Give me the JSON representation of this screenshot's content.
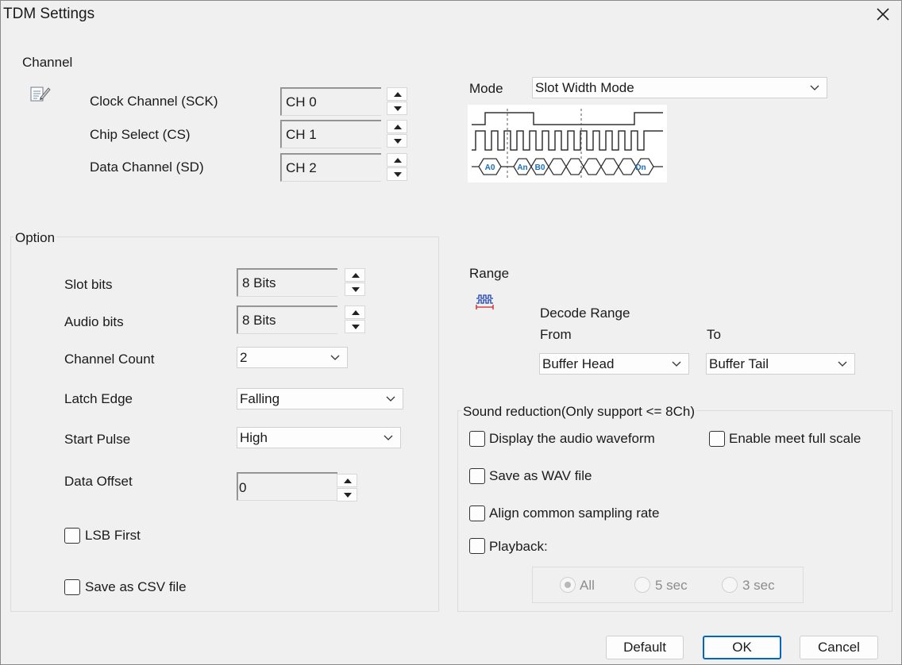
{
  "window": {
    "title": "TDM Settings",
    "close_icon": "close-icon"
  },
  "channel": {
    "group_label": "Channel",
    "icon": "edit-note-icon",
    "rows": [
      {
        "label": "Clock Channel (SCK)",
        "value": "CH 0"
      },
      {
        "label": "Chip Select (CS)",
        "value": "CH 1"
      },
      {
        "label": "Data Channel (SD)",
        "value": "CH 2"
      }
    ]
  },
  "mode": {
    "label": "Mode",
    "value": "Slot Width Mode",
    "diagram": {
      "data_labels": [
        "A0",
        "An",
        "B0",
        "Dn"
      ]
    }
  },
  "option": {
    "group_label": "Option",
    "slot_bits": {
      "label": "Slot bits",
      "value": "8 Bits"
    },
    "audio_bits": {
      "label": "Audio bits",
      "value": "8 Bits"
    },
    "channel_count": {
      "label": "Channel Count",
      "value": "2"
    },
    "latch_edge": {
      "label": "Latch Edge",
      "value": "Falling"
    },
    "start_pulse": {
      "label": "Start Pulse",
      "value": "High"
    },
    "data_offset": {
      "label": "Data Offset",
      "value": "0"
    },
    "lsb_first": {
      "label": "LSB First",
      "checked": false
    },
    "save_csv": {
      "label": "Save as CSV file",
      "checked": false
    }
  },
  "range": {
    "group_label": "Range",
    "icon": "waveform-range-icon",
    "decode_range_label": "Decode Range",
    "from_label": "From",
    "to_label": "To",
    "from_value": "Buffer Head",
    "to_value": "Buffer Tail"
  },
  "sound": {
    "group_label": "Sound reduction(Only support <= 8Ch)",
    "display_waveform": {
      "label": "Display the audio waveform",
      "checked": false
    },
    "enable_full_scale": {
      "label": "Enable meet full scale",
      "checked": false
    },
    "save_wav": {
      "label": "Save as WAV file",
      "checked": false
    },
    "align_rate": {
      "label": "Align common sampling rate",
      "checked": false
    },
    "playback": {
      "label": "Playback:",
      "checked": false
    },
    "playback_options": [
      {
        "label": "All",
        "selected": true
      },
      {
        "label": "5 sec",
        "selected": false
      },
      {
        "label": "3 sec",
        "selected": false
      }
    ]
  },
  "buttons": {
    "default": "Default",
    "ok": "OK",
    "cancel": "Cancel"
  },
  "colors": {
    "accent": "#0067c0",
    "diagram_text": "#1a6fb8"
  }
}
